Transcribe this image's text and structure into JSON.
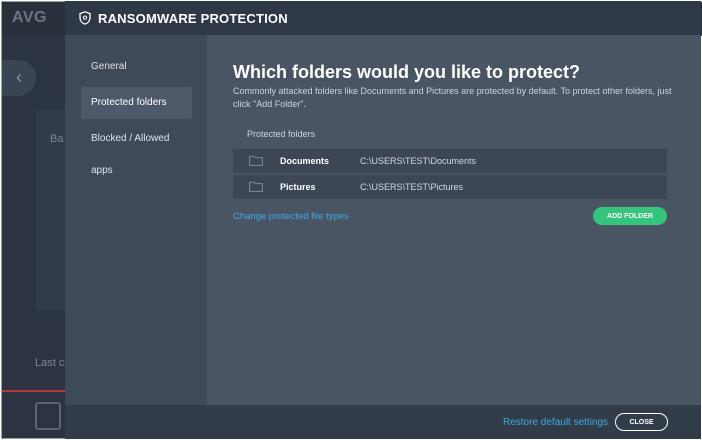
{
  "background_app": {
    "logo_text": "AVG",
    "back_icon": "chevron-left-icon",
    "partial_text_1": "Ba",
    "partial_text_2": "Last co"
  },
  "dialog": {
    "title": "RANSOMWARE PROTECTION",
    "title_icon": "shield-icon",
    "sidebar": {
      "items": [
        {
          "label": "General",
          "active": false
        },
        {
          "label": "Protected folders",
          "active": true
        },
        {
          "label": "Blocked / Allowed apps",
          "active": false
        }
      ]
    },
    "main": {
      "heading": "Which folders would you like to protect?",
      "description": "Commonly attacked folders like Documents and Pictures are protected by default. To protect other folders, just click \"Add Folder\".",
      "section_label": "Protected folders",
      "folders": [
        {
          "name": "Documents",
          "path": "C:\\USERS\\TEST\\Documents",
          "icon": "folder-icon"
        },
        {
          "name": "Pictures",
          "path": "C:\\USERS\\TEST\\Pictures",
          "icon": "folder-icon"
        }
      ],
      "change_link": "Change protected file types",
      "add_button": "ADD FOLDER"
    },
    "footer": {
      "restore_link": "Restore default settings",
      "close_button": "CLOSE"
    }
  },
  "colors": {
    "accent_green": "#34c47c",
    "link_blue": "#3ea8e5",
    "dialog_bg": "#4a5564",
    "sidebar_bg": "#3f4a58"
  }
}
